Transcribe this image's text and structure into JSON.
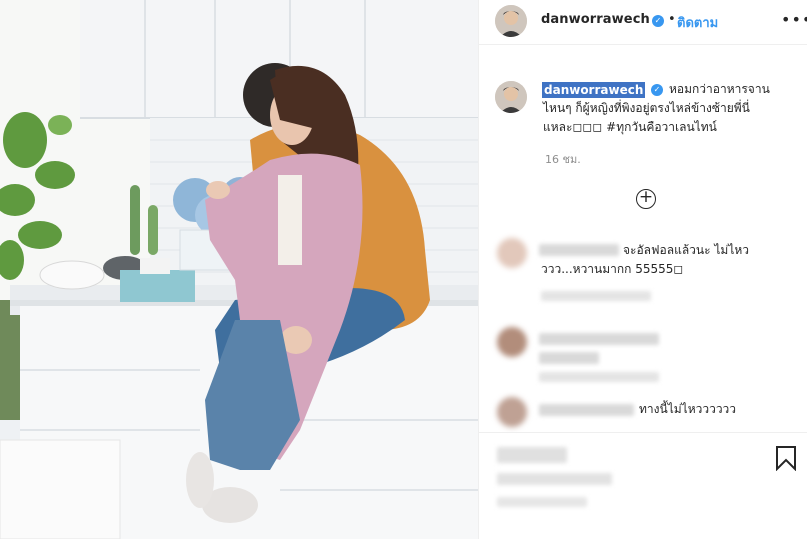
{
  "post": {
    "username": "danworrawech",
    "verified": true,
    "separator": "•",
    "follow_label": "ติดตาม",
    "more_label": "•••"
  },
  "caption": {
    "username": "danworrawech",
    "line1": "หอมกว่าอาหารจาน",
    "line2": "ไหนๆ ก็ผู้หญิงที่พิงอยู่ตรงไหล่ข้างซ้ายพี่นี่",
    "line3": "แหละ◻◻◻ #ทุกวันคือวาเลนไทน์",
    "time": "16 ชม."
  },
  "load_more_icon": "plus-circle-icon",
  "comments": [
    {
      "line1": "จะอัลฟอลแล้วนะ ไม่ไหว",
      "line2": "ววว...หวานมากก 55555◻"
    },
    {
      "line1": "",
      "line2": ""
    },
    {
      "line1": "ทางนี้ไม่ไหวววววว",
      "line2": ""
    }
  ],
  "icons": {
    "verified": "verified-badge-icon",
    "bookmark": "bookmark-icon"
  },
  "colors": {
    "link_blue": "#3897f0",
    "verified_blue": "#3897f0",
    "highlight": "#3f73c4",
    "muted": "#8e8e8e"
  }
}
